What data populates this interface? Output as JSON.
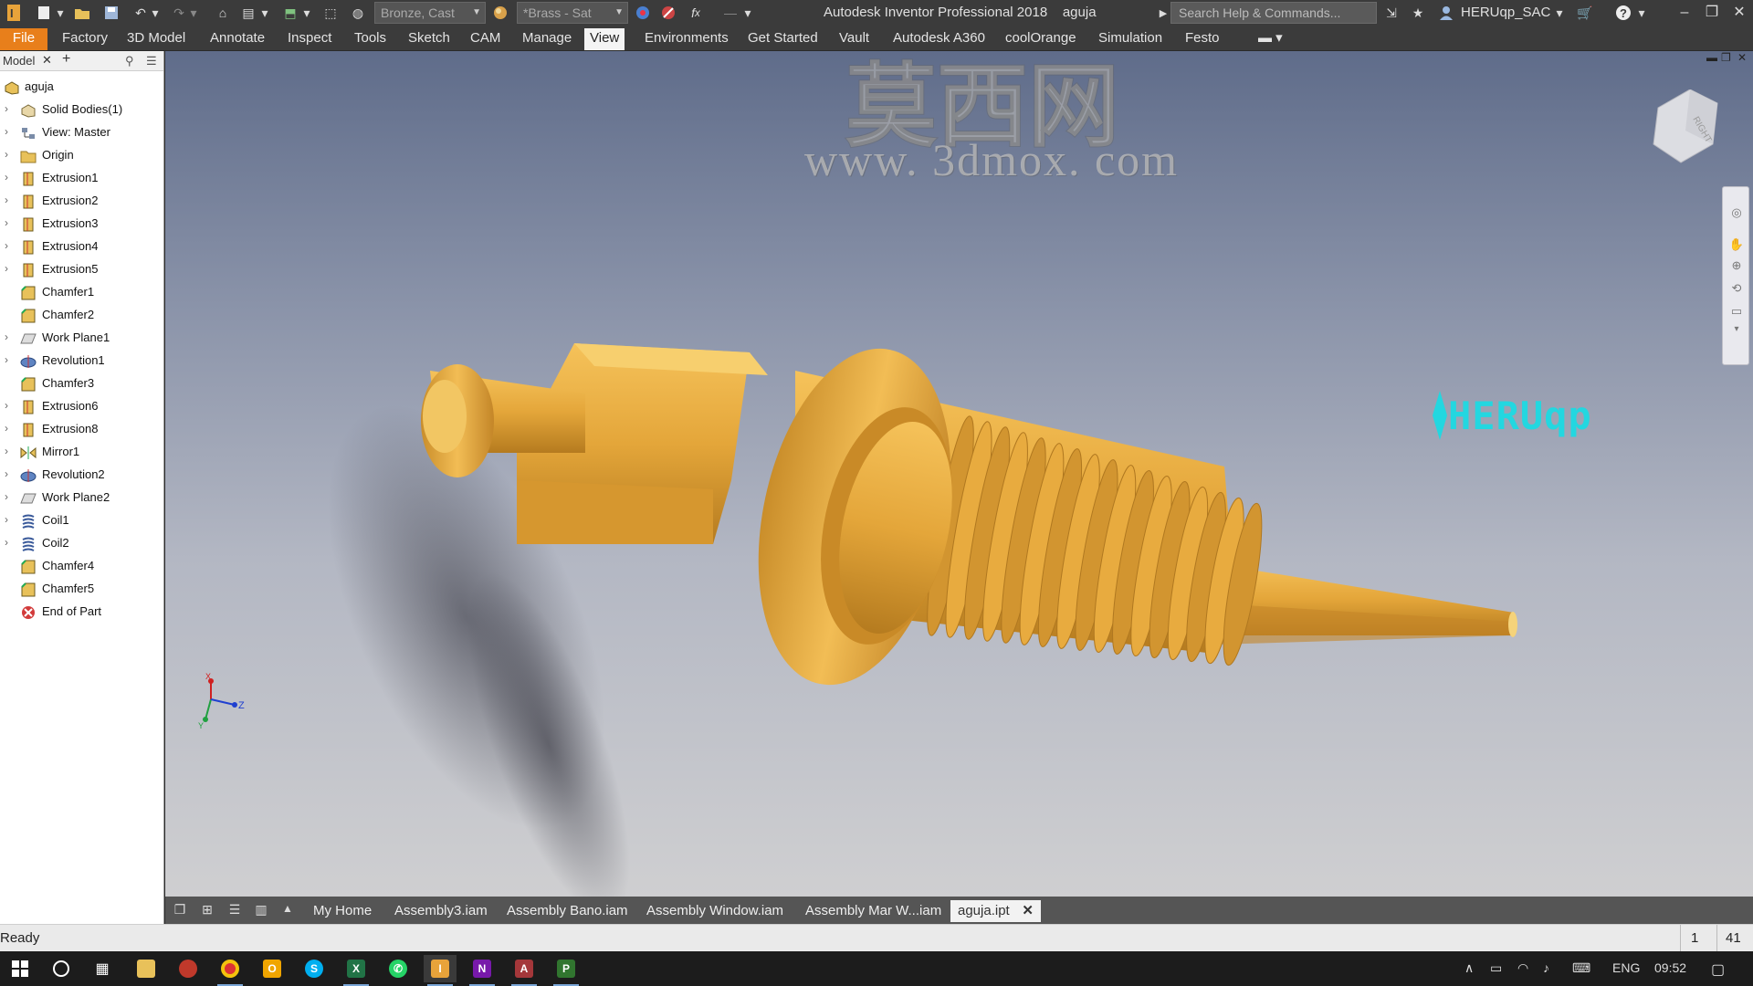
{
  "window": {
    "app_title": "Autodesk Inventor Professional 2018",
    "doc_name": "aguja",
    "search_placeholder": "Search Help & Commands...",
    "user": "HERUqp_SAC"
  },
  "quick_access": {
    "material": "Bronze, Cast",
    "appearance": "*Brass - Sat"
  },
  "ribbon_tabs": [
    "File",
    "Factory",
    "3D Model",
    "Annotate",
    "Inspect",
    "Tools",
    "Sketch",
    "CAM",
    "Manage",
    "View",
    "Environments",
    "Get Started",
    "Vault",
    "Autodesk A360",
    "coolOrange",
    "Simulation",
    "Festo"
  ],
  "active_tab": "View",
  "browser": {
    "tab_label": "Model",
    "root": "aguja",
    "nodes": [
      {
        "label": "Solid Bodies(1)",
        "icon": "solid-bodies-icon",
        "expandable": true
      },
      {
        "label": "View: Master",
        "icon": "view-icon",
        "expandable": true
      },
      {
        "label": "Origin",
        "icon": "folder-icon",
        "expandable": true
      },
      {
        "label": "Extrusion1",
        "icon": "extrusion-icon",
        "expandable": true
      },
      {
        "label": "Extrusion2",
        "icon": "extrusion-icon",
        "expandable": true
      },
      {
        "label": "Extrusion3",
        "icon": "extrusion-icon",
        "expandable": true
      },
      {
        "label": "Extrusion4",
        "icon": "extrusion-icon",
        "expandable": true
      },
      {
        "label": "Extrusion5",
        "icon": "extrusion-icon",
        "expandable": true
      },
      {
        "label": "Chamfer1",
        "icon": "chamfer-icon",
        "expandable": false
      },
      {
        "label": "Chamfer2",
        "icon": "chamfer-icon",
        "expandable": false
      },
      {
        "label": "Work Plane1",
        "icon": "work-plane-icon",
        "expandable": true
      },
      {
        "label": "Revolution1",
        "icon": "revolution-icon",
        "expandable": true
      },
      {
        "label": "Chamfer3",
        "icon": "chamfer-icon",
        "expandable": false
      },
      {
        "label": "Extrusion6",
        "icon": "extrusion-icon",
        "expandable": true
      },
      {
        "label": "Extrusion8",
        "icon": "extrusion-icon",
        "expandable": true
      },
      {
        "label": "Mirror1",
        "icon": "mirror-icon",
        "expandable": true
      },
      {
        "label": "Revolution2",
        "icon": "revolution-icon",
        "expandable": true
      },
      {
        "label": "Work Plane2",
        "icon": "work-plane-icon",
        "expandable": true
      },
      {
        "label": "Coil1",
        "icon": "coil-icon",
        "expandable": true
      },
      {
        "label": "Coil2",
        "icon": "coil-icon",
        "expandable": true
      },
      {
        "label": "Chamfer4",
        "icon": "chamfer-icon",
        "expandable": false
      },
      {
        "label": "Chamfer5",
        "icon": "chamfer-icon",
        "expandable": false
      },
      {
        "label": "End of Part",
        "icon": "end-of-part-icon",
        "expandable": false
      }
    ]
  },
  "viewport": {
    "watermark_cn": "莫西网",
    "watermark_url": "www. 3dmox. com",
    "logo_text": "HERUqp",
    "viewcube_face": "RIGHT",
    "model_color": "#e4a63a",
    "axis": {
      "x": "X",
      "y": "Y",
      "z": "Z"
    }
  },
  "doc_tabs": [
    "My Home",
    "Assembly3.iam",
    "Assembly Bano.iam",
    "Assembly Window.iam",
    "Assembly Mar W...iam",
    "aguja.ipt"
  ],
  "active_doc": "aguja.ipt",
  "status": {
    "text": "Ready",
    "num1": "1",
    "num2": "41"
  },
  "taskbar": {
    "lang": "ENG",
    "time": "09:52"
  },
  "colors": {
    "file_tab": "#e87f1b",
    "logo": "#23d7e0",
    "model": "#e4a63a"
  }
}
